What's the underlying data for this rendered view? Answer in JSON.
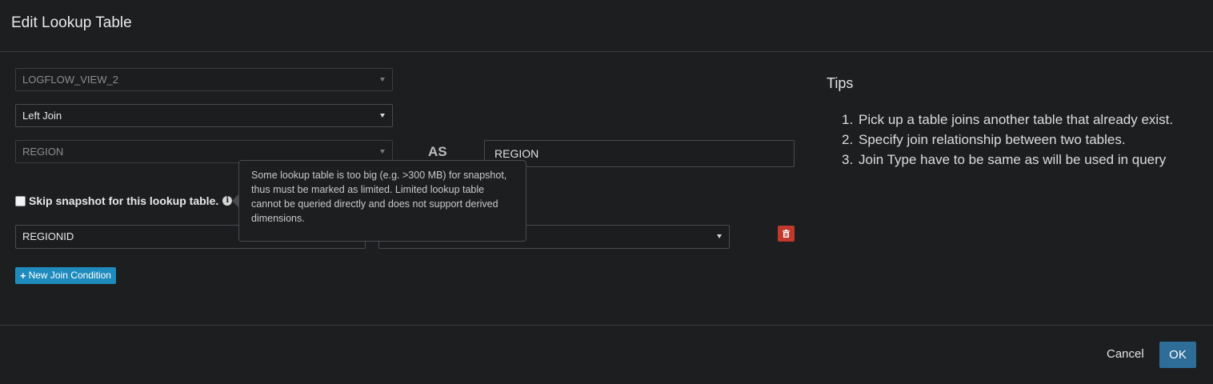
{
  "modal": {
    "title": "Edit Lookup Table"
  },
  "form": {
    "fact_table_select": "LOGFLOW_VIEW_2",
    "join_type_select": "Left Join",
    "lookup_table_select": "REGION",
    "as_label": "AS",
    "alias_value": "REGION",
    "skip_snapshot_label": "Skip snapshot for this lookup table.",
    "skip_snapshot_checked": false,
    "tooltip_text": "Some lookup table is too big (e.g. >300 MB) for snapshot, thus must be marked as limited. Limited lookup table cannot be queried directly and does not support derived dimensions.",
    "join_condition": {
      "left_column": "REGIONID",
      "right_column": ""
    },
    "new_join_condition_label": "New Join Condition",
    "new_join_icon": "plus-icon",
    "delete_icon": "trash-icon"
  },
  "tips": {
    "title": "Tips",
    "items": [
      {
        "num": "1.",
        "text": "Pick up a table joins another table that already exist."
      },
      {
        "num": "2.",
        "text": "Specify join relationship between two tables."
      },
      {
        "num": "3.",
        "text": "Join Type have to be same as will be used in query"
      }
    ]
  },
  "footer": {
    "cancel_label": "Cancel",
    "ok_label": "OK"
  },
  "colors": {
    "background": "#1d1e20",
    "primary_button": "#2d6d98",
    "info_button": "#1f8bbd",
    "danger_button": "#c0392b"
  }
}
